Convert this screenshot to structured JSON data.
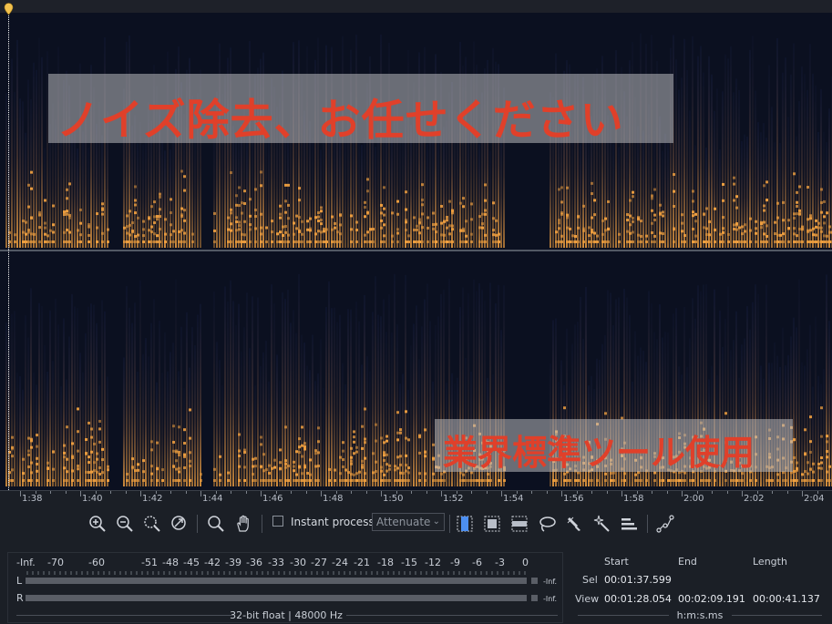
{
  "spectrogram": {
    "overlay_top": "ノイズ除去、お任せください",
    "overlay_bottom": "業界標準ツール使用"
  },
  "ruler": {
    "ticks": [
      "1:38",
      "1:40",
      "1:42",
      "1:44",
      "1:46",
      "1:48",
      "1:50",
      "1:52",
      "1:54",
      "1:56",
      "1:58",
      "2:00",
      "2:02",
      "2:04"
    ]
  },
  "toolbar": {
    "instant_process_label": "Instant process",
    "instant_process_checked": false,
    "attenuate_value": "Attenuate",
    "icons": [
      "zoom-in-icon",
      "zoom-out-icon",
      "zoom-selection-icon",
      "zoom-reset-icon",
      "magnify-icon",
      "hand-icon",
      "time-selection-icon",
      "time-frequency-selection-icon",
      "frequency-selection-icon",
      "lasso-icon",
      "brush-icon",
      "magic-wand-icon",
      "harmonic-selection-icon",
      "curve-tool-icon"
    ]
  },
  "meter": {
    "scale": [
      "-Inf.",
      "-70",
      "-60",
      "-51",
      "-48",
      "-45",
      "-42",
      "-39",
      "-36",
      "-33",
      "-30",
      "-27",
      "-24",
      "-21",
      "-18",
      "-15",
      "-12",
      "-9",
      "-6",
      "-3",
      "0"
    ],
    "channel_left": "L",
    "channel_right": "R",
    "left_peak": "-Inf.",
    "right_peak": "-Inf.",
    "format": "32-bit float | 48000 Hz"
  },
  "selection": {
    "headers": {
      "start": "Start",
      "end": "End",
      "length": "Length"
    },
    "sel": {
      "label": "Sel",
      "start": "00:01:37.599"
    },
    "view": {
      "label": "View",
      "start": "00:01:28.054",
      "end": "00:02:09.191",
      "length": "00:00:41.137"
    },
    "units": "h:m:s.ms"
  },
  "colors": {
    "accent": "#4d8ff0",
    "overlay_text": "#e0402a",
    "spectrogram_hot": "#f0a040",
    "spectrogram_cold": "#1a2450"
  }
}
